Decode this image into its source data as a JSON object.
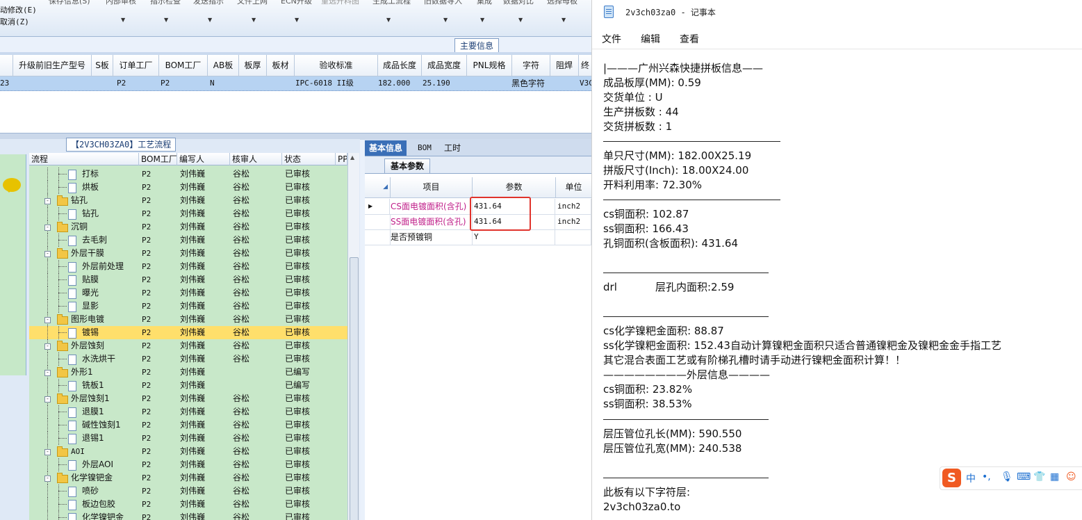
{
  "erp": {
    "ribbon_top_items": [
      "保存信息(S)",
      "内部审核",
      "指示检查",
      "发送指示",
      "文件上网",
      "ECN升级",
      "重选开料图",
      "生成工流程",
      "旧数据导入",
      "集成",
      "数据对比",
      "选择母板"
    ],
    "ribbon_left": [
      "动修改(E)",
      "取消(Z)"
    ],
    "main_info_tab": "主要信息",
    "grid1_columns": [
      "升级前旧生产型号",
      "S板",
      "订单工厂",
      "BOM工厂",
      "AB板",
      "板厚",
      "板材",
      "验收标准",
      "成品长度",
      "成品宽度",
      "PNL规格",
      "字符",
      "阻焊",
      "终"
    ],
    "grid1_row": {
      "c0": "23",
      "order_factory": "P2",
      "bom_factory": "P2",
      "ab": "N",
      "standard": "IPC-6018 II级",
      "length": "182.000",
      "width": "25.190",
      "char": "黑色字符",
      "last": "V3C"
    },
    "flow_title": "【2V3CH03ZA0】工艺流程",
    "flow_columns": [
      "流程",
      "BOM工厂",
      "编写人",
      "核审人",
      "状态",
      "PP"
    ],
    "flow_rows": [
      {
        "name": "打标",
        "level": 2,
        "type": "doc",
        "bom": "P2",
        "writer": "刘伟巍",
        "reviewer": "谷松",
        "status": "已审核"
      },
      {
        "name": "烘板",
        "level": 2,
        "type": "doc",
        "bom": "P2",
        "writer": "刘伟巍",
        "reviewer": "谷松",
        "status": "已审核"
      },
      {
        "name": "钻孔",
        "level": 1,
        "type": "folder",
        "bom": "P2",
        "writer": "刘伟巍",
        "reviewer": "谷松",
        "status": "已审核"
      },
      {
        "name": "钻孔",
        "level": 2,
        "type": "doc",
        "bom": "P2",
        "writer": "刘伟巍",
        "reviewer": "谷松",
        "status": "已审核"
      },
      {
        "name": "沉铜",
        "level": 1,
        "type": "folder",
        "bom": "P2",
        "writer": "刘伟巍",
        "reviewer": "谷松",
        "status": "已审核"
      },
      {
        "name": "去毛刺",
        "level": 2,
        "type": "doc",
        "bom": "P2",
        "writer": "刘伟巍",
        "reviewer": "谷松",
        "status": "已审核"
      },
      {
        "name": "外层干膜",
        "level": 1,
        "type": "folder",
        "bom": "P2",
        "writer": "刘伟巍",
        "reviewer": "谷松",
        "status": "已审核"
      },
      {
        "name": "外层前处理",
        "level": 2,
        "type": "doc",
        "bom": "P2",
        "writer": "刘伟巍",
        "reviewer": "谷松",
        "status": "已审核"
      },
      {
        "name": "贴膜",
        "level": 2,
        "type": "doc",
        "bom": "P2",
        "writer": "刘伟巍",
        "reviewer": "谷松",
        "status": "已审核"
      },
      {
        "name": "曝光",
        "level": 2,
        "type": "doc",
        "bom": "P2",
        "writer": "刘伟巍",
        "reviewer": "谷松",
        "status": "已审核"
      },
      {
        "name": "显影",
        "level": 2,
        "type": "doc",
        "bom": "P2",
        "writer": "刘伟巍",
        "reviewer": "谷松",
        "status": "已审核"
      },
      {
        "name": "图形电镀",
        "level": 1,
        "type": "folder",
        "bom": "P2",
        "writer": "刘伟巍",
        "reviewer": "谷松",
        "status": "已审核"
      },
      {
        "name": "镀锡",
        "level": 2,
        "type": "doc",
        "bom": "P2",
        "writer": "刘伟巍",
        "reviewer": "谷松",
        "status": "已审核",
        "selected": true
      },
      {
        "name": "外层蚀刻",
        "level": 1,
        "type": "folder",
        "bom": "P2",
        "writer": "刘伟巍",
        "reviewer": "谷松",
        "status": "已审核"
      },
      {
        "name": "水洗烘干",
        "level": 2,
        "type": "doc",
        "bom": "P2",
        "writer": "刘伟巍",
        "reviewer": "谷松",
        "status": "已审核"
      },
      {
        "name": "外形1",
        "level": 1,
        "type": "folder",
        "bom": "P2",
        "writer": "刘伟巍",
        "reviewer": "",
        "status": "已编写"
      },
      {
        "name": "铣板1",
        "level": 2,
        "type": "doc",
        "bom": "P2",
        "writer": "刘伟巍",
        "reviewer": "",
        "status": "已编写"
      },
      {
        "name": "外层蚀刻1",
        "level": 1,
        "type": "folder",
        "bom": "P2",
        "writer": "刘伟巍",
        "reviewer": "谷松",
        "status": "已审核"
      },
      {
        "name": "退膜1",
        "level": 2,
        "type": "doc",
        "bom": "P2",
        "writer": "刘伟巍",
        "reviewer": "谷松",
        "status": "已审核"
      },
      {
        "name": "碱性蚀刻1",
        "level": 2,
        "type": "doc",
        "bom": "P2",
        "writer": "刘伟巍",
        "reviewer": "谷松",
        "status": "已审核"
      },
      {
        "name": "退锡1",
        "level": 2,
        "type": "doc",
        "bom": "P2",
        "writer": "刘伟巍",
        "reviewer": "谷松",
        "status": "已审核"
      },
      {
        "name": "AOI",
        "level": 1,
        "type": "folder",
        "bom": "P2",
        "writer": "刘伟巍",
        "reviewer": "谷松",
        "status": "已审核"
      },
      {
        "name": "外层AOI",
        "level": 2,
        "type": "doc",
        "bom": "P2",
        "writer": "刘伟巍",
        "reviewer": "谷松",
        "status": "已审核"
      },
      {
        "name": "化学镍钯金",
        "level": 1,
        "type": "folder",
        "bom": "P2",
        "writer": "刘伟巍",
        "reviewer": "谷松",
        "status": "已审核"
      },
      {
        "name": "喷砂",
        "level": 2,
        "type": "doc",
        "bom": "P2",
        "writer": "刘伟巍",
        "reviewer": "谷松",
        "status": "已审核"
      },
      {
        "name": "板边包胶",
        "level": 2,
        "type": "doc",
        "bom": "P2",
        "writer": "刘伟巍",
        "reviewer": "谷松",
        "status": "已审核"
      },
      {
        "name": "化学镍钯金",
        "level": 2,
        "type": "doc",
        "bom": "P2",
        "writer": "刘伟巍",
        "reviewer": "谷松",
        "status": "已审核"
      }
    ],
    "right_tabs": [
      "基本信息",
      "BOM",
      "工时"
    ],
    "sub_tab": "基本参数",
    "param_columns": [
      "项目",
      "参数",
      "单位"
    ],
    "params": [
      {
        "item": "CS面电镀面积(含孔)",
        "value": "431.64",
        "unit": "inch2"
      },
      {
        "item": "SS面电镀面积(含孔)",
        "value": "431.64",
        "unit": "inch2"
      },
      {
        "item": "是否预镀铜",
        "value": "Y",
        "unit": ""
      }
    ]
  },
  "notepad": {
    "title": "2v3ch03za0 - 记事本",
    "menu": [
      "文件",
      "编辑",
      "查看"
    ],
    "lines": {
      "l1": "|———广州兴森快捷拼板信息——",
      "l2": "成品板厚(MM): 0.59",
      "l3": "交货单位 : U",
      "l4": "生产拼板数 : 44",
      "l5": "交货拼板数 : 1",
      "l6": "单只尺寸(MM): 182.00X25.19",
      "l7": "拼版尺寸(Inch): 18.00X24.00",
      "l8": "开料利用率: 72.30%",
      "l9": "cs铜面积: 102.87",
      "l10": "ss铜面积: 166.43",
      "l11": "孔铜面积(含板面积): 431.64",
      "l12a": "drl",
      "l12b": "层孔内面积:2.59",
      "l13": "cs化学镍粑金面积: 88.87",
      "l14": "ss化学镍粑金面积: 152.43自动计算镍粑金面积只适合普通镍粑金及镍粑金金手指工艺",
      "l15": "其它混合表面工艺或有阶梯孔槽时请手动进行镍粑金面积计算！！",
      "l16": "————————外层信息————",
      "l17": "cs铜面积: 23.82%",
      "l18": "ss铜面积: 38.53%",
      "l19": "层压管位孔长(MM): 590.550",
      "l20": "层压管位孔宽(MM): 240.538",
      "l21": "此板有以下字符层:",
      "l22": "2v3ch03za0.to"
    }
  },
  "ime": {
    "logo": "S",
    "mode": "中",
    "punct": "•,"
  }
}
